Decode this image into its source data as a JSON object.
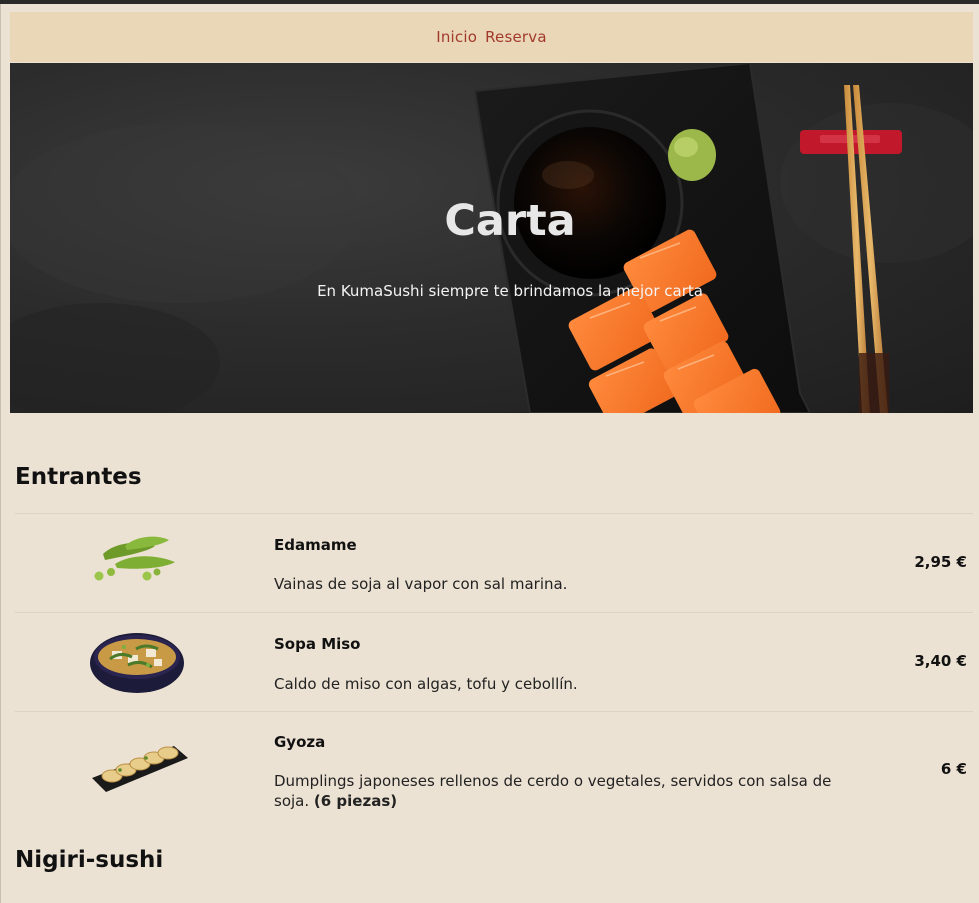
{
  "nav": {
    "items": [
      "Inicio",
      "Reserva"
    ]
  },
  "hero": {
    "title": "Carta",
    "subtitle": "En KumaSushi siempre te brindamos la mejor carta"
  },
  "sections": [
    {
      "title": "Entrantes",
      "items": [
        {
          "name": "Edamame",
          "description": "Vainas de soja al vapor con sal marina.",
          "price": "2,95 €",
          "image": "edamame-image"
        },
        {
          "name": "Sopa Miso",
          "description": "Caldo de miso con algas, tofu y cebollín.",
          "price": "3,40 €",
          "image": "miso-soup-image"
        },
        {
          "name": "Gyoza",
          "description": "Dumplings japoneses rellenos de cerdo o vegetales, servidos con salsa de soja.",
          "description_bold": "(6 piezas)",
          "price": "6 €",
          "image": "gyoza-image"
        }
      ]
    },
    {
      "title": "Nigiri-sushi",
      "items": []
    }
  ],
  "colors": {
    "page_bg": "#ece2d3",
    "nav_bg": "#ead7b7",
    "nav_link": "#a23a2c"
  }
}
